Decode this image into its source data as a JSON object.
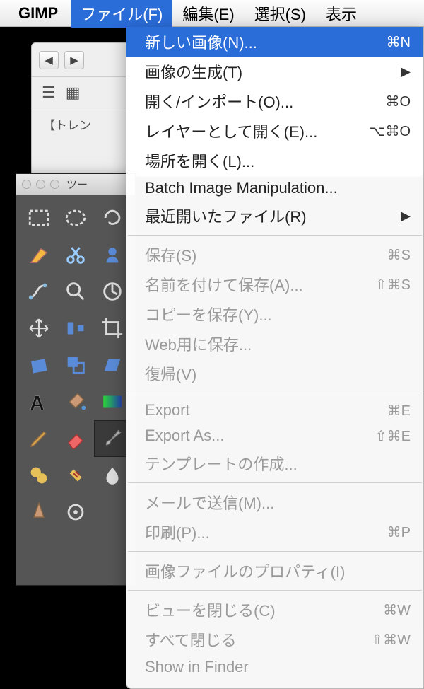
{
  "menubar": {
    "app": "GIMP",
    "items": [
      "ファイル(F)",
      "編集(E)",
      "選択(S)",
      "表示"
    ]
  },
  "dropdown": {
    "items": [
      {
        "label": "新しい画像(N)...",
        "shortcut": "⌘N",
        "selected": true
      },
      {
        "label": "画像の生成(T)",
        "submenu": true
      },
      {
        "label": "開く/インポート(O)...",
        "shortcut": "⌘O"
      },
      {
        "label": "レイヤーとして開く(E)...",
        "shortcut": "⌥⌘O"
      },
      {
        "label": "場所を開く(L)..."
      },
      {
        "label": "Batch Image Manipulation..."
      },
      {
        "label": "最近開いたファイル(R)",
        "submenu": true
      },
      {
        "sep": true
      },
      {
        "label": "保存(S)",
        "shortcut": "⌘S",
        "disabled": true
      },
      {
        "label": "名前を付けて保存(A)...",
        "shortcut": "⇧⌘S",
        "disabled": true
      },
      {
        "label": "コピーを保存(Y)...",
        "disabled": true
      },
      {
        "label": "Web用に保存...",
        "disabled": true
      },
      {
        "label": "復帰(V)",
        "disabled": true
      },
      {
        "sep": true
      },
      {
        "label": "Export",
        "shortcut": "⌘E",
        "disabled": true
      },
      {
        "label": "Export As...",
        "shortcut": "⇧⌘E",
        "disabled": true
      },
      {
        "label": "テンプレートの作成...",
        "disabled": true
      },
      {
        "sep": true
      },
      {
        "label": "メールで送信(M)...",
        "disabled": true
      },
      {
        "label": "印刷(P)...",
        "shortcut": "⌘P",
        "disabled": true
      },
      {
        "sep": true
      },
      {
        "label": "画像ファイルのプロパティ(I)",
        "disabled": true
      },
      {
        "sep": true
      },
      {
        "label": "ビューを閉じる(C)",
        "shortcut": "⌘W",
        "disabled": true
      },
      {
        "label": "すべて閉じる",
        "shortcut": "⇧⌘W",
        "disabled": true
      },
      {
        "label": "Show in Finder",
        "disabled": true
      }
    ]
  },
  "toolbox": {
    "title": "ツー"
  },
  "browser": {
    "trend": "【トレン"
  }
}
